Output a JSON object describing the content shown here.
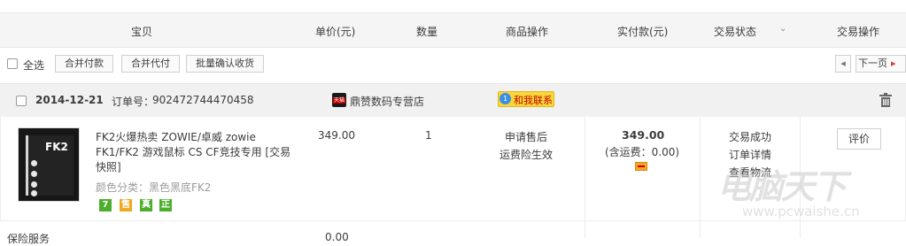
{
  "header": {
    "columns": [
      "宝贝",
      "单价(元)",
      "数量",
      "商品操作",
      "实付款(元)",
      "交易状态",
      "交易操作"
    ]
  },
  "batch": {
    "select_all_label": "全选",
    "merge_pay": "合并付款",
    "merge_proxy_pay": "合并代付",
    "batch_confirm": "批量确认收货",
    "prev_arrow": "◂",
    "next_page": "下一页",
    "next_arrow": "▸"
  },
  "order": {
    "date": "2014-12-21",
    "order_no_label": "订单号：",
    "order_no": "902472744470458",
    "shop_badge": "天猫",
    "shop_name": "鼎赞数码专营店",
    "contact_badge": "1",
    "contact_label": "和我联系"
  },
  "item": {
    "image_text": "FK2",
    "title_line1": "FK2火爆热卖 ZOWIE/卓威 zowie",
    "title_line2": "FK1/FK2 游戏鼠标 CS CF竞技专用 [交易",
    "title_line3": "快照]",
    "variant": "颜色分类：黑色黑底FK2",
    "tags": [
      "7",
      "售",
      "真",
      "正"
    ],
    "unit_price": "349.00",
    "quantity": "1",
    "op_after_sale": "申请售后",
    "op_insurance": "运费险生效",
    "paid": "349.00",
    "shipping_note": "(含运费：0.00)",
    "status": "交易成功",
    "detail_link": "订单详情",
    "logistics_link": "查看物流",
    "action_button": "评价"
  },
  "footer_row": {
    "label": "保险服务",
    "value": "0.00"
  },
  "watermark": {
    "brand": "电脑天下",
    "url": "www.pcwaishe.cn"
  },
  "colors": {
    "accent_red": "#e4393c",
    "tmall_red": "#c40000",
    "contact_yellow": "#f7d73a",
    "tag_green": "#4caf2c",
    "tag_yellow": "#f0a81e"
  }
}
